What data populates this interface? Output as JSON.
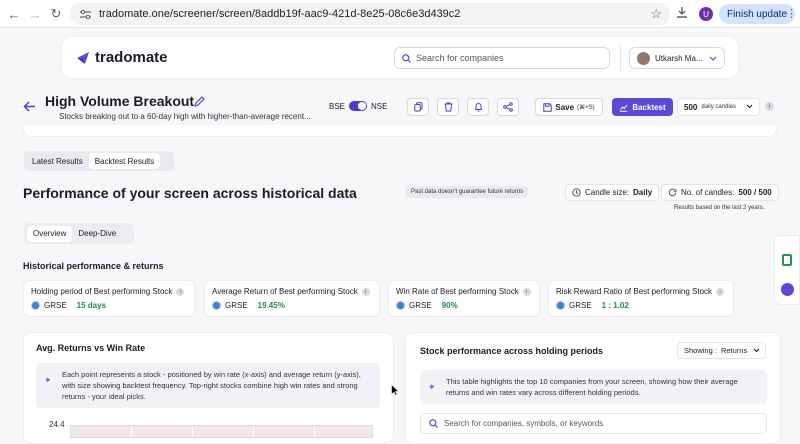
{
  "browser": {
    "url": "tradomate.one/screener/screen/8addb19f-aac9-421d-8e25-08c6e3d439c2",
    "avatar_letter": "U",
    "finish_update": "Finish update"
  },
  "app": {
    "brand": "tradomate",
    "search_placeholder": "Search for companies",
    "user_name": "Utkarsh Ma...",
    "brand_color": "#5b49d6"
  },
  "screen": {
    "title": "High Volume Breakout",
    "subtitle": "Stocks breaking out to a 60-day high with higher-than-average recent...",
    "exchange_left": "BSE",
    "exchange_right": "NSE",
    "save_label": "Save",
    "save_shortcut": "(⌘+S)",
    "backtest_label": "Backtest",
    "candles_value": "500",
    "candles_unit": "daily candles"
  },
  "results_tabs": [
    "Latest Results",
    "Backtest Results"
  ],
  "performance": {
    "title": "Performance of your screen across historical data",
    "disclaimer": "Past data doesn't guarantee future returns",
    "candle_size_label": "Candle size:",
    "candle_size_value": "Daily",
    "num_candles_label": "No. of candles:",
    "num_candles_value": "500 / 500",
    "based_on": "Results based on the last 2 years."
  },
  "view_tabs": [
    "Overview",
    "Deep-Dive"
  ],
  "historical": {
    "heading": "Historical performance & returns",
    "kpis": [
      {
        "label": "Holding period of Best performing Stock",
        "symbol": "GRSE",
        "value": "15 days"
      },
      {
        "label": "Average Return of Best performing Stock",
        "symbol": "GRSE",
        "value": "19.45%"
      },
      {
        "label": "Win Rate of Best performing Stock",
        "symbol": "GRSE",
        "value": "90%"
      },
      {
        "label": "Risk Reward Ratio of Best performing Stock",
        "symbol": "GRSE",
        "value": "1 : 1.02"
      }
    ]
  },
  "scatter_card": {
    "title": "Avg. Returns vs Win Rate",
    "note": "Each point represents a stock - positioned by win rate (x-axis) and average return (y-axis), with size showing backtest frequency. Top-right stocks combine high win rates and strong returns - your ideal picks.",
    "y_top_tick": "24.4"
  },
  "table_card": {
    "title": "Stock performance across holding periods",
    "showing_label": "Showing :",
    "showing_value": "Returns",
    "note": "This table highlights the top 10 companies from your screen, showing how their average returns and win rates vary across different holding periods.",
    "search_placeholder": "Search for companies, symbols, or keywords"
  }
}
